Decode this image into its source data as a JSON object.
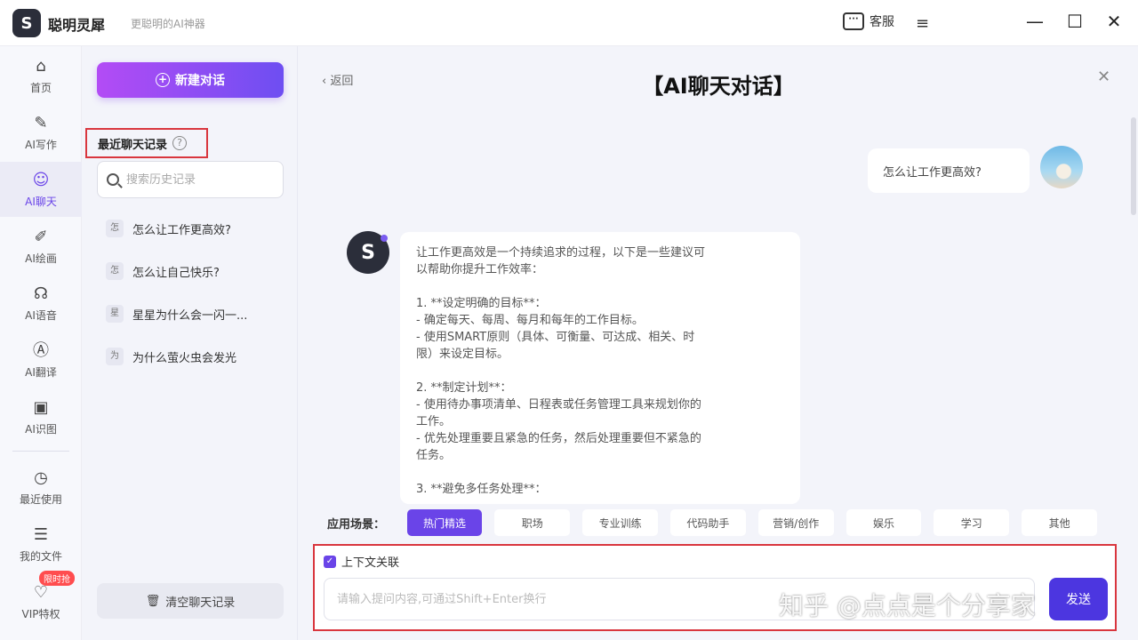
{
  "app": {
    "name": "聪明灵犀",
    "slogan": "更聪明的AI神器",
    "logo_text": "S"
  },
  "titlebar": {
    "service_label": "客服",
    "service_icon": "chat-icon",
    "menu_icon": "≡",
    "min": "—",
    "max": "☐",
    "close": "✕"
  },
  "nav": {
    "items": [
      {
        "label": "首页",
        "icon": "⌂"
      },
      {
        "label": "AI写作",
        "icon": "✎"
      },
      {
        "label": "AI聊天",
        "icon": "☺"
      },
      {
        "label": "AI绘画",
        "icon": "✐"
      },
      {
        "label": "AI语音",
        "icon": "☊"
      },
      {
        "label": "AI翻译",
        "icon": "Ⓐ"
      },
      {
        "label": "AI识图",
        "icon": "▣"
      },
      {
        "label": "最近使用",
        "icon": "◷"
      },
      {
        "label": "我的文件",
        "icon": "☰"
      },
      {
        "label": "VIP特权",
        "icon": "♡"
      }
    ],
    "vip_badge": "限时抢"
  },
  "history": {
    "new_chat_label": "新建对话",
    "title": "最近聊天记录",
    "help_icon": "?",
    "search_placeholder": "搜索历史记录",
    "items": [
      {
        "tag": "怎",
        "text": "怎么让工作更高效?"
      },
      {
        "tag": "怎",
        "text": "怎么让自己快乐?"
      },
      {
        "tag": "星",
        "text": "星星为什么会一闪一..."
      },
      {
        "tag": "为",
        "text": "为什么萤火虫会发光"
      }
    ],
    "clear_label": "清空聊天记录",
    "clear_icon": "🗑"
  },
  "chat": {
    "back_label": "‹  返回",
    "title": "【AI聊天对话】",
    "close_icon": "✕",
    "user_message": "怎么让工作更高效?",
    "bot_avatar_text": "S",
    "bot_lines": [
      "让工作更高效是一个持续追求的过程，以下是一些建议可",
      "以帮助你提升工作效率：",
      "",
      "1. **设定明确的目标**：",
      "- 确定每天、每周、每月和每年的工作目标。",
      "- 使用SMART原则（具体、可衡量、可达成、相关、时",
      "限）来设定目标。",
      "",
      "2. **制定计划**：",
      "- 使用待办事项清单、日程表或任务管理工具来规划你的",
      "工作。",
      "- 优先处理重要且紧急的任务，然后处理重要但不紧急的",
      "任务。",
      "",
      "3. **避免多任务处理**："
    ]
  },
  "scenes": {
    "label": "应用场景：",
    "items": [
      "热门精选",
      "职场",
      "专业训练",
      "代码助手",
      "营销/创作",
      "娱乐",
      "学习",
      "其他"
    ],
    "active_index": 0
  },
  "composer": {
    "context_label": "上下文关联",
    "context_checked": true,
    "placeholder": "请输入提问内容,可通过Shift+Enter换行",
    "send_label": "发送"
  },
  "watermark": "知乎 @点点是个分享家",
  "colors": {
    "accent": "#6a44e8",
    "gradient_start": "#b34cf5",
    "highlight_border": "#d9363e"
  }
}
